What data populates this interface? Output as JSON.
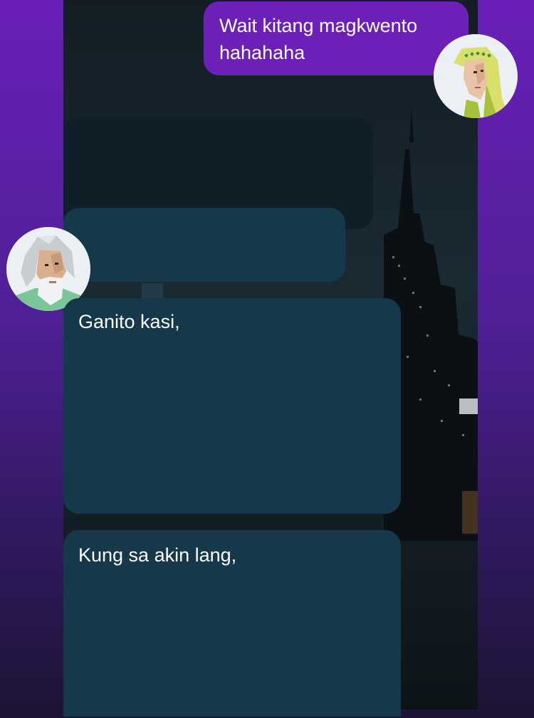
{
  "messages": {
    "outgoing_1": "Wait kitang magkwento hahahaha",
    "incoming_1": "",
    "incoming_2": "",
    "incoming_3": "Ganito kasi,",
    "incoming_4": "Kung sa akin lang,"
  },
  "avatars": {
    "self": "elf-woman-avatar",
    "other": "old-bearded-man-avatar"
  },
  "colors": {
    "outgoing_bubble": "#6c20b8",
    "incoming_bubble": "#15384a",
    "page_gradient_top": "#6a1fb8",
    "page_gradient_bottom": "#1d1434",
    "chat_background": "#121b22"
  }
}
